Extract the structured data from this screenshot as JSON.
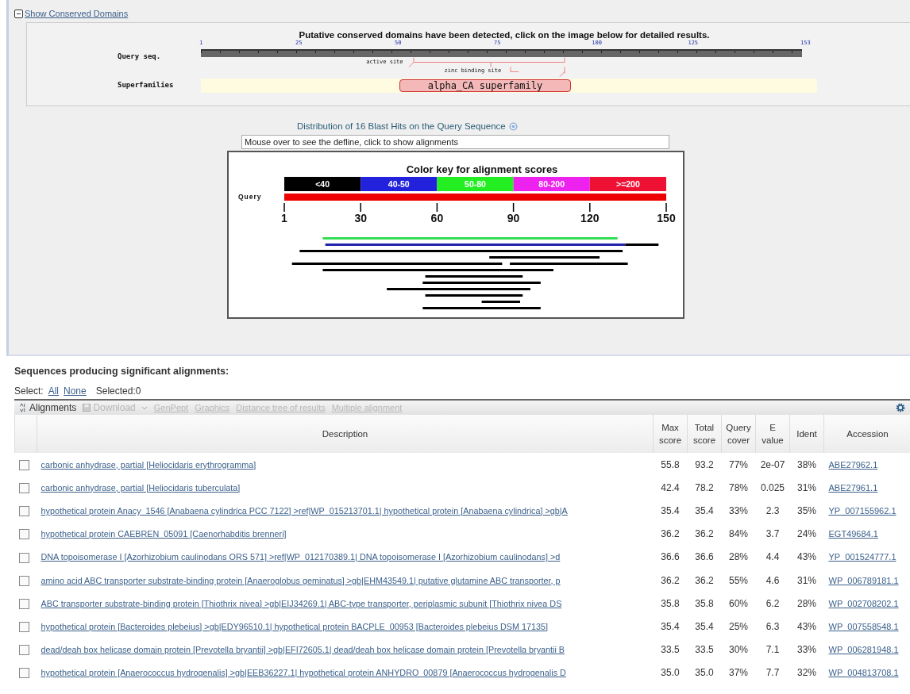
{
  "conserved_domains": {
    "toggle": {
      "label": "Show Conserved Domains",
      "expanded": true
    },
    "message": "Putative conserved domains have been detected, click on the image below for detailed results.",
    "query_label": "Query seq.",
    "ruler_ticks": [
      "1",
      "25",
      "50",
      "75",
      "100",
      "125",
      "153"
    ],
    "sites": [
      "active site",
      "zinc binding site"
    ],
    "superfamilies_label": "Superfamilies",
    "superfamily": "alpha_CA superfamily"
  },
  "distribution": {
    "title": "Distribution of 16 Blast Hits on the Query Sequence",
    "defline_field": "Mouse over to see the defline, click to show alignments",
    "key_title": "Color key for alignment scores",
    "color_key": [
      {
        "label": "<40",
        "color": "#000000"
      },
      {
        "label": "40-50",
        "color": "#2222dd"
      },
      {
        "label": "50-80",
        "color": "#22ee22"
      },
      {
        "label": "80-200",
        "color": "#ee22ee"
      },
      {
        "label": ">=200",
        "color": "#ee1133"
      }
    ],
    "query_label": "Query",
    "scale_ticks": [
      "1",
      "30",
      "60",
      "90",
      "120",
      "150"
    ]
  },
  "alignments": {
    "heading": "Sequences producing significant alignments:",
    "select_label": "Select:",
    "select_links": [
      "All",
      "None"
    ],
    "selected_count": "Selected:0",
    "toolbar": [
      {
        "label": "Alignments",
        "kind": "sort",
        "disabled": false
      },
      {
        "label": "Download",
        "kind": "download",
        "disabled": true
      },
      {
        "label": "GenPept",
        "kind": "link",
        "disabled": true
      },
      {
        "label": "Graphics",
        "kind": "link",
        "disabled": true
      },
      {
        "label": "Distance tree of results",
        "kind": "link",
        "disabled": true
      },
      {
        "label": "Multiple alignment",
        "kind": "link",
        "disabled": true
      }
    ],
    "columns": [
      "Description",
      "Max score",
      "Total score",
      "Query cover",
      "E value",
      "Ident",
      "Accession"
    ],
    "rows": [
      {
        "checked": false,
        "description": "carbonic anhydrase, partial [Heliocidaris erythrogramma]",
        "max_score": "55.8",
        "total_score": "93.2",
        "query_cover": "77%",
        "e_value": "2e-07",
        "ident": "38%",
        "accession": "ABE27962.1"
      },
      {
        "checked": false,
        "description": "carbonic anhydrase, partial [Heliocidaris tuberculata]",
        "max_score": "42.4",
        "total_score": "78.2",
        "query_cover": "78%",
        "e_value": "0.025",
        "ident": "31%",
        "accession": "ABE27961.1"
      },
      {
        "checked": false,
        "description": "hypothetical protein Anacy_1546 [Anabaena cylindrica PCC 7122] >ref|WP_015213701.1| hypothetical protein [Anabaena cylindrica] >gb|A",
        "max_score": "35.4",
        "total_score": "35.4",
        "query_cover": "33%",
        "e_value": "2.3",
        "ident": "35%",
        "accession": "YP_007155962.1"
      },
      {
        "checked": false,
        "description": "hypothetical protein CAEBREN_05091 [Caenorhabditis brenneri]",
        "max_score": "36.2",
        "total_score": "36.2",
        "query_cover": "84%",
        "e_value": "3.7",
        "ident": "24%",
        "accession": "EGT49684.1"
      },
      {
        "checked": false,
        "description": "DNA topoisomerase I [Azorhizobium caulinodans ORS 571] >ref|WP_012170389.1| DNA topoisomerase I [Azorhizobium caulinodans] >d",
        "max_score": "36.6",
        "total_score": "36.6",
        "query_cover": "28%",
        "e_value": "4.4",
        "ident": "43%",
        "accession": "YP_001524777.1"
      },
      {
        "checked": false,
        "description": "amino acid ABC transporter substrate-binding protein [Anaeroglobus geminatus] >gb|EHM43549.1| putative glutamine ABC transporter, p",
        "max_score": "36.2",
        "total_score": "36.2",
        "query_cover": "55%",
        "e_value": "4.6",
        "ident": "31%",
        "accession": "WP_006789181.1"
      },
      {
        "checked": false,
        "description": "ABC transporter substrate-binding protein [Thiothrix nivea] >gb|EIJ34269.1| ABC-type transporter, periplasmic subunit [Thiothrix nivea DS",
        "max_score": "35.8",
        "total_score": "35.8",
        "query_cover": "60%",
        "e_value": "6.2",
        "ident": "28%",
        "accession": "WP_002708202.1"
      },
      {
        "checked": false,
        "description": "hypothetical protein [Bacteroides plebeius] >gb|EDY96510.1| hypothetical protein BACPLE_00953 [Bacteroides plebeius DSM 17135]",
        "max_score": "35.4",
        "total_score": "35.4",
        "query_cover": "25%",
        "e_value": "6.3",
        "ident": "43%",
        "accession": "WP_007558548.1"
      },
      {
        "checked": false,
        "description": "dead/deah box helicase domain protein [Prevotella bryantii] >gb|EFI72605.1| dead/deah box helicase domain protein [Prevotella bryantii B",
        "max_score": "33.5",
        "total_score": "33.5",
        "query_cover": "30%",
        "e_value": "7.1",
        "ident": "33%",
        "accession": "WP_006281948.1"
      },
      {
        "checked": false,
        "description": "hypothetical protein [Anaerococcus hydrogenalis] >gb|EEB36227.1| hypothetical protein ANHYDRO_00879 [Anaerococcus hydrogenalis D",
        "max_score": "35.0",
        "total_score": "35.0",
        "query_cover": "37%",
        "e_value": "7.7",
        "ident": "32%",
        "accession": "WP_004813708.1"
      }
    ]
  }
}
